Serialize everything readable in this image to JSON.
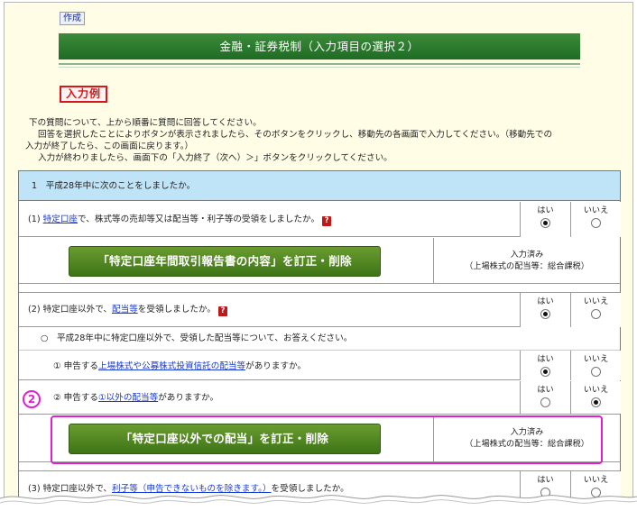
{
  "header": {
    "create_label": "作成",
    "title": "金融・証券税制（入力項目の選択２）",
    "example_label": "入力例"
  },
  "intro": {
    "line1": "下の質問について、上から順番に質問に回答してください。",
    "line2": "回答を選択したことによりボタンが表示されましたら、そのボタンをクリックし、移動先の各画面で入力してください。（移動先での",
    "line3": "入力が終了したら、この画面に戻ります。）",
    "line4": "入力が終わりましたら、画面下の「入力終了（次へ）＞」ボタンをクリックしてください。"
  },
  "section1": {
    "title": "1　平成28年中に次のことをしましたか。"
  },
  "yes_label": "はい",
  "no_label": "いいえ",
  "q1": {
    "prefix": "(1) ",
    "link": "特定口座",
    "suffix": "で、株式等の売却等又は配当等・利子等の受領をしましたか。",
    "answer": "はい",
    "button_label": "「特定口座年間取引報告書の内容」を訂正・削除",
    "status_line1": "入力済み",
    "status_line2": "（上場株式の配当等：総合課税）"
  },
  "q2": {
    "prefix": "(2) 特定口座以外で、",
    "link": "配当等",
    "suffix": "を受領しましたか。",
    "answer": "はい",
    "sub_header": "○　平成28年中に特定口座以外で、受領した配当等について、お答えください。",
    "sub1": {
      "prefix": "① 申告する",
      "link": "上場株式や公募株式投資信託の配当等",
      "suffix": "がありますか。",
      "answer": "はい"
    },
    "sub2": {
      "prefix": "② 申告する",
      "link": "①以外の配当等",
      "suffix": "がありますか。",
      "answer": "いいえ"
    },
    "button_label": "「特定口座以外での配当」を訂正・削除",
    "status_line1": "入力済み",
    "status_line2": "（上場株式の配当等：総合課税）"
  },
  "q3": {
    "prefix": "(3) 特定口座以外で、",
    "link": "利子等（申告できないものを除きます。）",
    "suffix": "を受領しましたか。"
  },
  "annotation": {
    "marker": "2"
  },
  "help_icon_glyph": "?",
  "colors": {
    "title_green": "#2a7a2e",
    "button_green": "#4f8a22",
    "section_blue": "#bfe3f7",
    "highlight_pink": "#e020d0",
    "example_red": "#d61818",
    "page_bg": "#fffde6"
  }
}
